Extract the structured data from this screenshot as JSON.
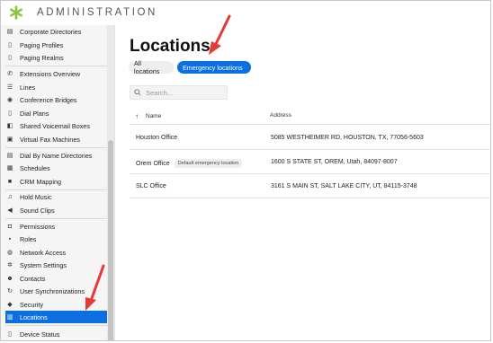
{
  "app": {
    "title": "ADMINISTRATION"
  },
  "sidebar": {
    "items": [
      {
        "label": "Corporate Directories",
        "icon": "address-book-icon"
      },
      {
        "label": "Paging Profiles",
        "icon": "document-icon"
      },
      {
        "label": "Paging Realms",
        "icon": "document-icon"
      },
      {
        "label": "Extensions Overview",
        "icon": "phone-icon"
      },
      {
        "label": "Lines",
        "icon": "lines-icon"
      },
      {
        "label": "Conference Bridges",
        "icon": "people-icon"
      },
      {
        "label": "Dial Plans",
        "icon": "document-icon"
      },
      {
        "label": "Shared Voicemail Boxes",
        "icon": "voicemail-icon"
      },
      {
        "label": "Virtual Fax Machines",
        "icon": "fax-icon"
      },
      {
        "label": "Dial By Name Directories",
        "icon": "address-book-icon"
      },
      {
        "label": "Schedules",
        "icon": "calendar-icon"
      },
      {
        "label": "CRM Mapping",
        "icon": "crm-icon"
      },
      {
        "label": "Hold Music",
        "icon": "music-note-icon"
      },
      {
        "label": "Sound Clips",
        "icon": "speaker-icon"
      },
      {
        "label": "Permissions",
        "icon": "lock-icon"
      },
      {
        "label": "Roles",
        "icon": "id-card-icon"
      },
      {
        "label": "Network Access",
        "icon": "globe-icon"
      },
      {
        "label": "System Settings",
        "icon": "gear-icon"
      },
      {
        "label": "Contacts",
        "icon": "contact-icon"
      },
      {
        "label": "User Synchronizations",
        "icon": "sync-icon"
      },
      {
        "label": "Security",
        "icon": "shield-icon"
      },
      {
        "label": "Locations",
        "icon": "building-icon",
        "active": true
      },
      {
        "label": "Device Status",
        "icon": "device-icon"
      }
    ]
  },
  "main": {
    "title": "Locations",
    "tabs": [
      {
        "label": "All locations",
        "active": false
      },
      {
        "label": "Emergency locations",
        "active": true
      }
    ],
    "search": {
      "placeholder": "Search..."
    },
    "table": {
      "columns": [
        "Name",
        "Address"
      ],
      "rows": [
        {
          "name": "Houston Office",
          "badge": "",
          "address": "5085 WESTHEIMER RD, HOUSTON, TX, 77056-5603"
        },
        {
          "name": "Orem Office",
          "badge": "Default emergency location",
          "address": "1600 S STATE ST, OREM, Utah, 84097-8007"
        },
        {
          "name": "SLC Office",
          "badge": "",
          "address": "3161 S MAIN ST, SALT LAKE CITY, UT, 84115-3748"
        }
      ]
    }
  },
  "colors": {
    "accent": "#0b6fe0",
    "logo": "#8cc63f",
    "callout": "#e53935"
  }
}
